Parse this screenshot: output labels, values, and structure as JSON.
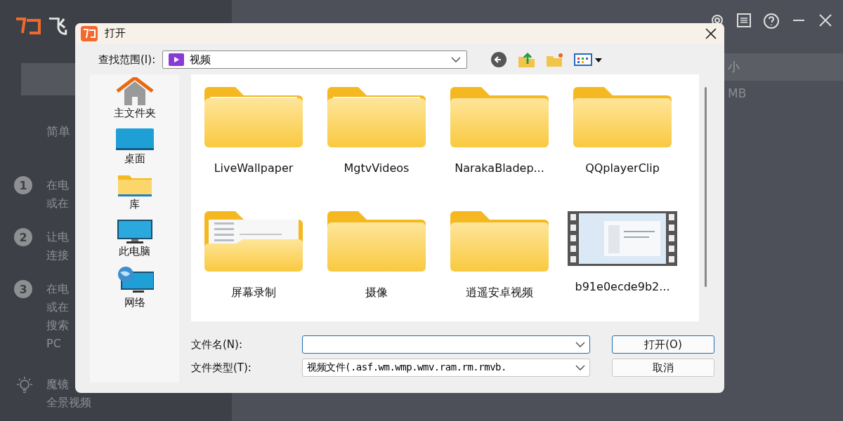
{
  "app": {
    "logo_text": "飞",
    "heading": "简单",
    "steps": [
      {
        "number": "1",
        "lines": [
          "在电",
          "或在"
        ]
      },
      {
        "number": "2",
        "lines": [
          "让电",
          "连接"
        ]
      },
      {
        "number": "3",
        "lines": [
          "在电",
          "或在",
          "搜索",
          "PC"
        ]
      }
    ],
    "tip_lines": [
      "魔镜",
      "全景视频"
    ],
    "size_header": "小",
    "size_value": "MB"
  },
  "dialog": {
    "title": "打开",
    "look_in_label": "查找范围(I):",
    "look_in_value": "视频",
    "places": [
      {
        "label": "主文件夹",
        "kind": "home"
      },
      {
        "label": "桌面",
        "kind": "desktop"
      },
      {
        "label": "库",
        "kind": "library"
      },
      {
        "label": "此电脑",
        "kind": "computer"
      },
      {
        "label": "网络",
        "kind": "network"
      }
    ],
    "files": [
      {
        "name": "LiveWallpaper",
        "kind": "folder-paper"
      },
      {
        "name": "MgtvVideos",
        "kind": "folder-paper"
      },
      {
        "name": "NarakaBladep...",
        "kind": "folder"
      },
      {
        "name": "QQplayerClip",
        "kind": "folder"
      },
      {
        "name": "屏幕录制",
        "kind": "folder-preview"
      },
      {
        "name": "摄像",
        "kind": "folder"
      },
      {
        "name": "逍遥安卓视频",
        "kind": "folder"
      },
      {
        "name": "b91e0ecde9b2...",
        "kind": "video"
      }
    ],
    "file_name_label": "文件名(N):",
    "file_type_label": "文件类型(T):",
    "file_type_value": "视频文件(.asf.wm.wmp.wmv.ram.rm.rmvb.",
    "buttons": [
      {
        "label": "打开(O)",
        "primary": true
      },
      {
        "label": "取消",
        "primary": false
      }
    ]
  }
}
